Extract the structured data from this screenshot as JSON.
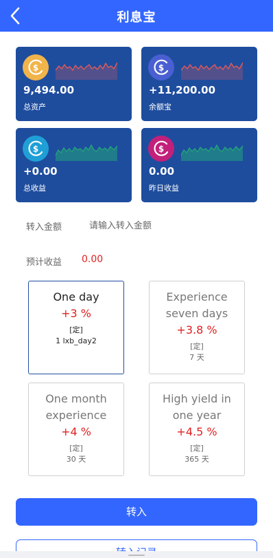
{
  "header": {
    "title": "利息宝",
    "back_icon": "chevron-left-icon"
  },
  "colors": {
    "brand": "#3366ff",
    "card_bg": "#1e4d9e",
    "positive_red": "#e02020",
    "spark_red": "#e05a5a",
    "spark_green": "#23a37a"
  },
  "stats": [
    {
      "value": "9,494.00",
      "label": "总资产",
      "icon": "dollar-coin-icon",
      "coin_color": "#f0b44a",
      "trend": "red"
    },
    {
      "value": "+11,200.00",
      "label": "余额宝",
      "icon": "dollar-coin-icon",
      "coin_color": "#4a5fd1",
      "trend": "red"
    },
    {
      "value": "+0.00",
      "label": "总收益",
      "icon": "dollar-coin-icon",
      "coin_color": "#1f9fd6",
      "trend": "green"
    },
    {
      "value": "0.00",
      "label": "昨日收益",
      "icon": "dollar-coin-icon",
      "coin_color": "#c2207a",
      "trend": "green"
    }
  ],
  "form": {
    "amount_label": "转入金额",
    "amount_placeholder": "请输入转入金额",
    "amount_value": "",
    "estimate_label": "预计收益",
    "estimate_value": "0.00"
  },
  "plans": [
    {
      "line1": "One day",
      "line2": "",
      "rate": "+3 %",
      "tag": "[定]",
      "duration": "1 lxb_day2",
      "selected": true
    },
    {
      "line1": "Experience",
      "line2": "seven days",
      "rate": "+3.8 %",
      "tag": "[定]",
      "duration": "7 天",
      "selected": false
    },
    {
      "line1": "One month",
      "line2": "experience",
      "rate": "+4 %",
      "tag": "[定]",
      "duration": "30 天",
      "selected": false
    },
    {
      "line1": "High yield in",
      "line2": "one year",
      "rate": "+4.5 %",
      "tag": "[定]",
      "duration": "365 天",
      "selected": false
    }
  ],
  "buttons": {
    "transfer_in": "转入",
    "records": "转入记录"
  }
}
